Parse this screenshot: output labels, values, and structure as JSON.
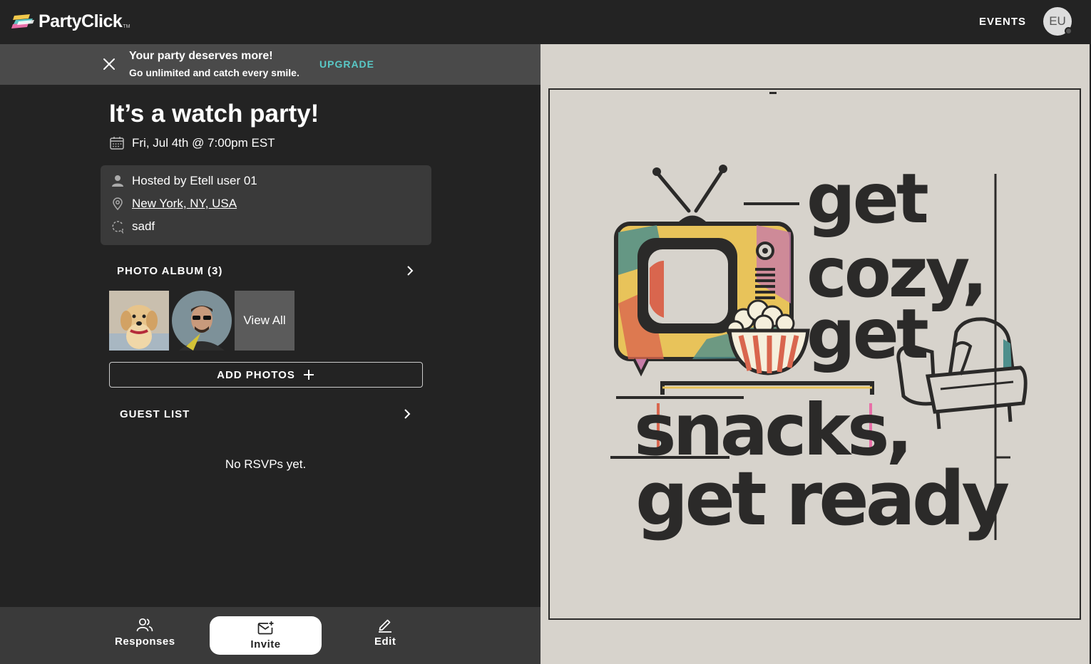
{
  "header": {
    "logo_text": "PartyClick",
    "logo_tm": "TM",
    "events_label": "EVENTS",
    "avatar_initials": "EU"
  },
  "banner": {
    "title": "Your party deserves more!",
    "subtitle": "Go unlimited and catch every smile.",
    "upgrade_label": "UPGRADE"
  },
  "event": {
    "title": "It’s a watch party!",
    "date": "Fri, Jul 4th @ 7:00pm EST",
    "host": "Hosted by Etell user 01",
    "location": "New York, NY, USA",
    "note": "sadf"
  },
  "photo_album": {
    "label": "PHOTO ALBUM (3)",
    "view_all_label": "View All",
    "add_photos_label": "ADD PHOTOS"
  },
  "guest_list": {
    "label": "GUEST LIST",
    "empty_text": "No RSVPs yet."
  },
  "bottom_bar": {
    "responses_label": "Responses",
    "invite_label": "Invite",
    "edit_label": "Edit"
  },
  "invitation": {
    "lines": [
      "get",
      "cozy,",
      "get",
      "snacks,",
      "get ready"
    ]
  },
  "colors": {
    "background": "#232323",
    "panel": "#3a3a3a",
    "accent": "#59c9c7",
    "card_bg": "#d7d3cc",
    "ink": "#2b2a29"
  }
}
